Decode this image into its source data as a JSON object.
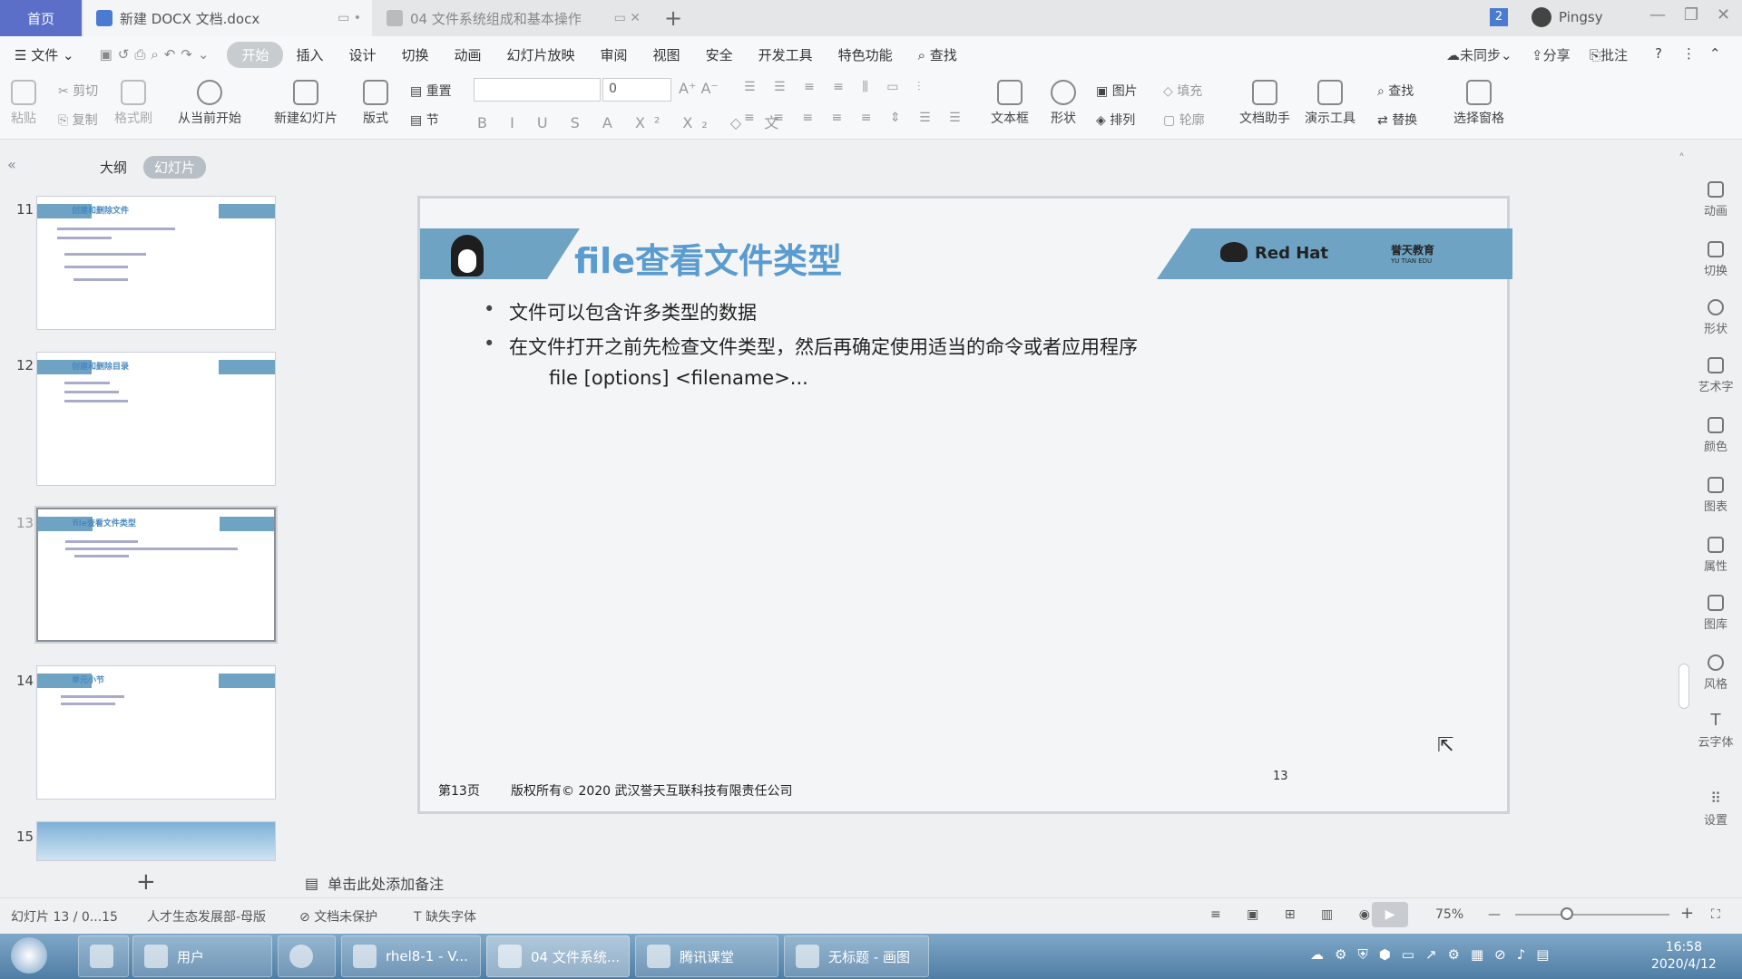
{
  "titlebar": {
    "home_tab": "首页",
    "doc_tab": "新建 DOCX 文档.docx",
    "ppt_tab": "04 文件系统组成和基本操作",
    "badge": "2",
    "user": "Pingsy"
  },
  "menu": [
    "文件",
    "开始",
    "插入",
    "设计",
    "切换",
    "动画",
    "幻灯片放映",
    "审阅",
    "视图",
    "安全",
    "开发工具",
    "特色功能",
    "查找"
  ],
  "menu_right": {
    "sync": "未同步",
    "share": "分享",
    "comment": "批注"
  },
  "ribbon": {
    "paste": "粘贴",
    "cut": "剪切",
    "copy": "复制",
    "format_painter": "格式刷",
    "from_current": "从当前开始",
    "new_slide": "新建幻灯片",
    "layout": "版式",
    "reset": "重置",
    "section": "节",
    "font_size": "0",
    "textbox": "文本框",
    "shape": "形状",
    "picture": "图片",
    "fill": "填充",
    "arrange": "排列",
    "outline": "轮廓",
    "doc_assistant": "文档助手",
    "present_tools": "演示工具",
    "find": "查找",
    "replace": "替换",
    "select_pane": "选择窗格"
  },
  "panel": {
    "tab_outline": "大纲",
    "tab_slides": "幻灯片",
    "thumbs": [
      {
        "num": "11",
        "title": "创建和删除文件"
      },
      {
        "num": "12",
        "title": "创建和删除目录"
      },
      {
        "num": "13",
        "title": "file查看文件类型"
      },
      {
        "num": "14",
        "title": "单元小节"
      },
      {
        "num": "15",
        "title": ""
      }
    ]
  },
  "slide": {
    "title": "file查看文件类型",
    "redhat": "Red Hat",
    "edu": "誉天教育",
    "edu_sub": "YU TIAN EDU",
    "bullets": [
      "文件可以包含许多类型的数据",
      "在文件打开之前先检查文件类型，然后再确定使用适当的命令或者应用程序"
    ],
    "command": "file [options] <filename>...",
    "footer_page": "第13页",
    "footer_copy": "版权所有© 2020 武汉誉天互联科技有限责任公司",
    "page_num": "13"
  },
  "notes": "单击此处添加备注",
  "right_sidebar": [
    "动画",
    "切换",
    "形状",
    "艺术字",
    "颜色",
    "图表",
    "属性",
    "图库",
    "风格",
    "云字体",
    "设置"
  ],
  "status": {
    "slide": "幻灯片 13 / 0...15",
    "template": "人才生态发展部-母版",
    "protect": "文档未保护",
    "fonts": "缺失字体",
    "zoom": "75%"
  },
  "taskbar": {
    "items": [
      "用户",
      "rhel8-1 - V...",
      "04 文件系统...",
      "腾讯课堂",
      "无标题 - 画图"
    ],
    "time": "16:58",
    "date": "2020/4/12"
  }
}
